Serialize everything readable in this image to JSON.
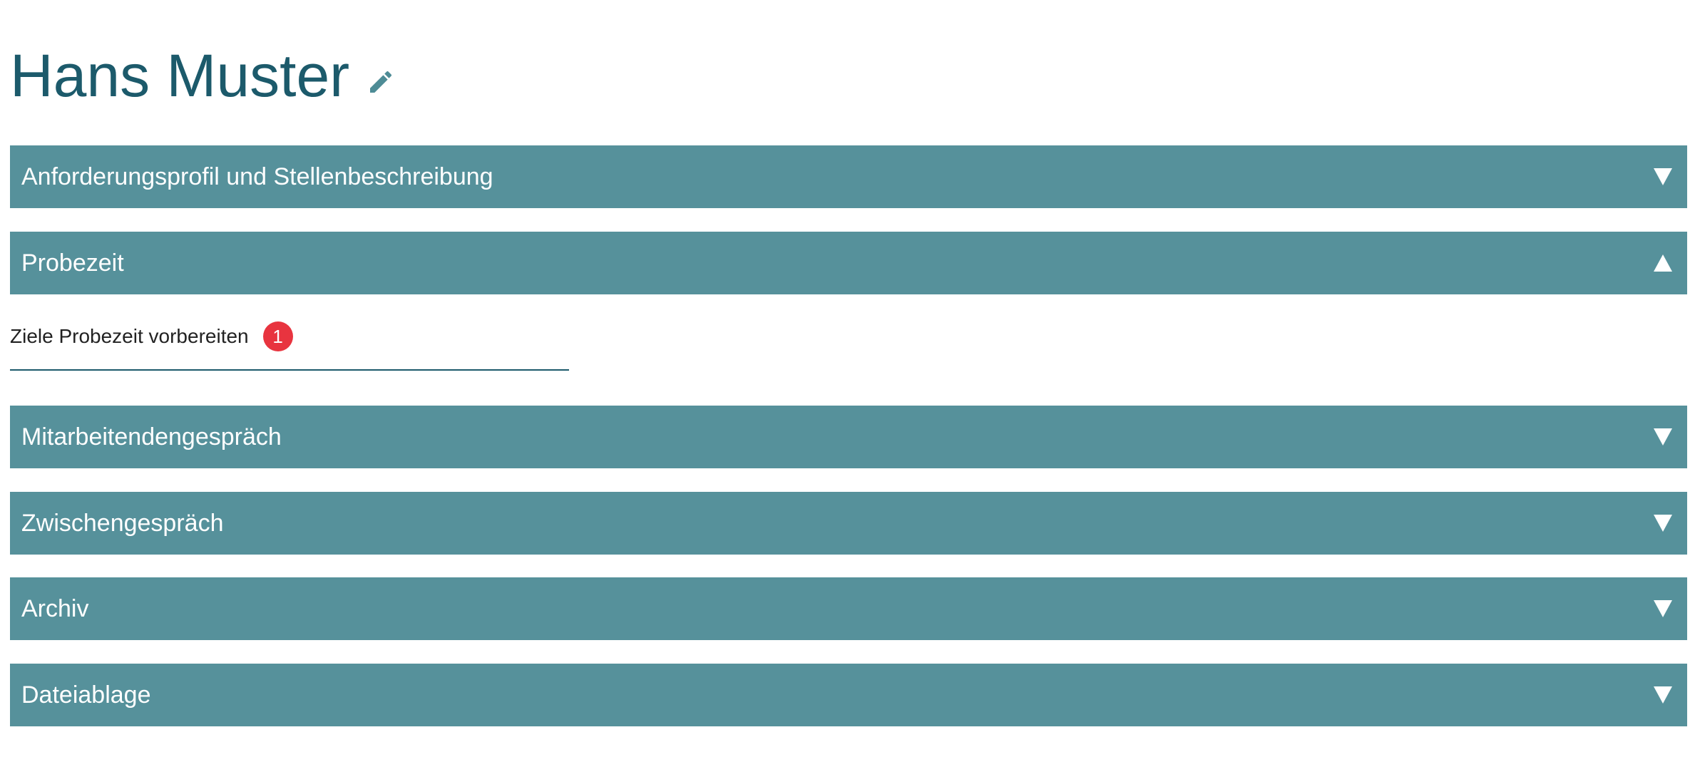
{
  "employee": {
    "name": "Hans Muster"
  },
  "colors": {
    "title": "#1c5a6b",
    "panel": "#56919b",
    "badge": "#e8343f"
  },
  "sections": [
    {
      "label": "Anforderungsprofil und Stellenbeschreibung",
      "expanded": false
    },
    {
      "label": "Probezeit",
      "expanded": true
    },
    {
      "label": "Mitarbeitendengespräch",
      "expanded": false
    },
    {
      "label": "Zwischengespräch",
      "expanded": false
    },
    {
      "label": "Archiv",
      "expanded": false
    },
    {
      "label": "Dateiablage",
      "expanded": false
    }
  ],
  "probezeit": {
    "task_label": "Ziele Probezeit vorbereiten",
    "task_badge": "1"
  }
}
